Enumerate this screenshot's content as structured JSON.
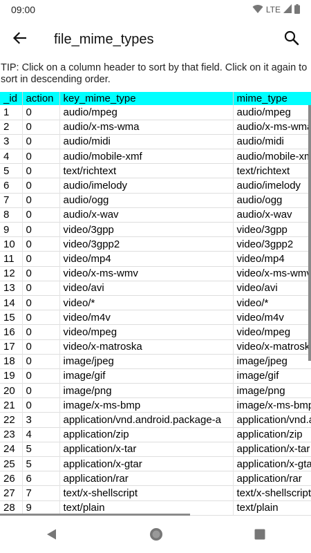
{
  "status": {
    "time": "09:00",
    "network": "LTE"
  },
  "app_bar": {
    "title": "file_mime_types"
  },
  "tip": "TIP: Click on a column header to sort by that field. Click on it again to sort in descending order.",
  "table": {
    "columns": [
      "_id",
      "action",
      "key_mime_type",
      "mime_type"
    ],
    "rows": [
      [
        "1",
        "0",
        "audio/mpeg",
        "audio/mpeg"
      ],
      [
        "2",
        "0",
        "audio/x-ms-wma",
        "audio/x-ms-wma"
      ],
      [
        "3",
        "0",
        "audio/midi",
        "audio/midi"
      ],
      [
        "4",
        "0",
        "audio/mobile-xmf",
        "audio/mobile-xmf"
      ],
      [
        "5",
        "0",
        "text/richtext",
        "text/richtext"
      ],
      [
        "6",
        "0",
        "audio/imelody",
        "audio/imelody"
      ],
      [
        "7",
        "0",
        "audio/ogg",
        "audio/ogg"
      ],
      [
        "8",
        "0",
        "audio/x-wav",
        "audio/x-wav"
      ],
      [
        "9",
        "0",
        "video/3gpp",
        "video/3gpp"
      ],
      [
        "10",
        "0",
        "video/3gpp2",
        "video/3gpp2"
      ],
      [
        "11",
        "0",
        "video/mp4",
        "video/mp4"
      ],
      [
        "12",
        "0",
        "video/x-ms-wmv",
        "video/x-ms-wmv"
      ],
      [
        "13",
        "0",
        "video/avi",
        "video/avi"
      ],
      [
        "14",
        "0",
        "video/*",
        "video/*"
      ],
      [
        "15",
        "0",
        "video/m4v",
        "video/m4v"
      ],
      [
        "16",
        "0",
        "video/mpeg",
        "video/mpeg"
      ],
      [
        "17",
        "0",
        "video/x-matroska",
        "video/x-matroska"
      ],
      [
        "18",
        "0",
        "image/jpeg",
        "image/jpeg"
      ],
      [
        "19",
        "0",
        "image/gif",
        "image/gif"
      ],
      [
        "20",
        "0",
        "image/png",
        "image/png"
      ],
      [
        "21",
        "0",
        "image/x-ms-bmp",
        "image/x-ms-bmp"
      ],
      [
        "22",
        "3",
        "application/vnd.android.package-a",
        "application/vnd.android.package-archive"
      ],
      [
        "23",
        "4",
        "application/zip",
        "application/zip"
      ],
      [
        "24",
        "5",
        "application/x-tar",
        "application/x-tar"
      ],
      [
        "25",
        "5",
        "application/x-gtar",
        "application/x-gtar"
      ],
      [
        "26",
        "6",
        "application/rar",
        "application/rar"
      ],
      [
        "27",
        "7",
        "text/x-shellscript",
        "text/x-shellscript"
      ],
      [
        "28",
        "9",
        "text/plain",
        "text/plain"
      ]
    ]
  },
  "colors": {
    "header_bg": "#00ffff"
  },
  "icons": {
    "back": "arrow-left-icon",
    "search": "search-icon",
    "nav_back": "triangle-back-icon",
    "nav_home": "circle-home-icon",
    "nav_recents": "square-recents-icon"
  }
}
